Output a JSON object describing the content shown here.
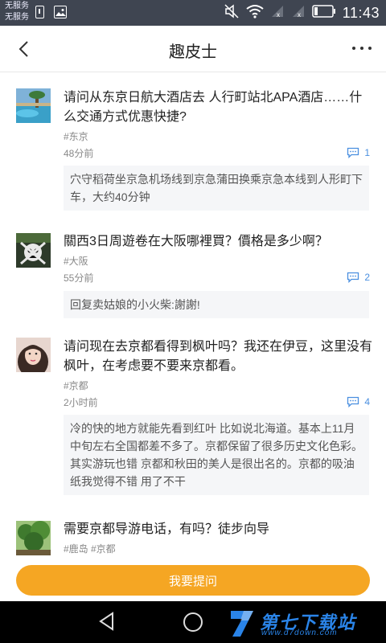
{
  "status_bar": {
    "carrier_line_1": "无服务",
    "carrier_line_2": "无服务",
    "time": "11:43"
  },
  "header": {
    "title": "趣皮士"
  },
  "posts": [
    {
      "question": "请问从东京日航大酒店去 人行町站北APA酒店……什么交通方式优惠快捷?",
      "tags": "#东京",
      "time": "48分前",
      "comment_count": "1",
      "reply": "穴守稻荷坐京急机场线到京急蒲田换乘京急本线到人形町下车，大约40分钟"
    },
    {
      "question": "關西3日周遊卷在大阪哪裡買？價格是多少啊？",
      "tags": "#大阪",
      "time": "55分前",
      "comment_count": "2",
      "reply": "回复卖姑娘的小火柴:謝謝!"
    },
    {
      "question": "请问现在去京都看得到枫叶吗？我还在伊豆，这里没有枫叶，在考虑要不要来京都看。",
      "tags": "#京都",
      "time": "2小时前",
      "comment_count": "4",
      "reply": "冷的快的地方就能先看到红叶 比如说北海道。基本上11月中旬左右全国都差不多了。京都保留了很多历史文化色彩。其实游玩也错 京都和秋田的美人是很出名的。京都的吸油纸我觉得不错 用了不干"
    },
    {
      "question": "需要京都导游电话，有吗？徒步向导",
      "tags": "#鹿岛 #京都",
      "time": "",
      "comment_count": "",
      "reply": ""
    }
  ],
  "ask_button": {
    "label": "我要提问"
  },
  "watermark": {
    "title": "第七下载站",
    "url": "www.d7down.com"
  },
  "colors": {
    "status_bar": "#3f4551",
    "accent_orange": "#f5a623",
    "comment_blue": "#4a8fe0",
    "reply_bg": "#f5f6f8"
  }
}
